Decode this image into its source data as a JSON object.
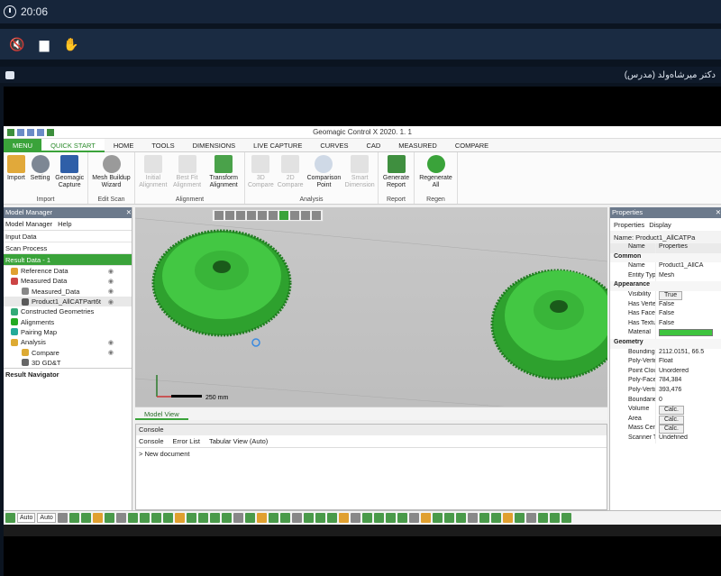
{
  "topbar": {
    "time": "20:06"
  },
  "presenter": {
    "name": "دکتر میرشاه‌ولد (مدرس)"
  },
  "app": {
    "title": "Geomagic Control X 2020. 1. 1",
    "tabs": [
      "MENU",
      "QUICK START",
      "HOME",
      "TOOLS",
      "DIMENSIONS",
      "LIVE CAPTURE",
      "CURVES",
      "CAD",
      "MEASURED",
      "COMPARE"
    ],
    "active_tab": "QUICK START",
    "ribbon": {
      "import": {
        "name": "Import",
        "buttons": [
          "Import",
          "Setting",
          "Geomagic Capture"
        ]
      },
      "edit_scan": {
        "name": "Edit Scan",
        "buttons": [
          "Mesh Buildup Wizard"
        ]
      },
      "alignment": {
        "name": "Alignment",
        "buttons": [
          "Initial Alignment",
          "Best Fit Alignment",
          "Transform Alignment"
        ]
      },
      "analysis": {
        "name": "Analysis",
        "buttons": [
          "3D Compare",
          "2D Compare",
          "Comparison Point",
          "Smart Dimension"
        ]
      },
      "report": {
        "name": "Report",
        "buttons": [
          "Generate Report"
        ]
      },
      "regen": {
        "name": "Regen",
        "buttons": [
          "Regenerate All"
        ]
      }
    },
    "model_manager": {
      "title": "Model Manager",
      "tabs": [
        "Model Manager",
        "Help"
      ],
      "input_data": "Input Data",
      "scan_process": "Scan Process",
      "result_data": "Result Data - 1",
      "items": [
        {
          "label": "Reference Data",
          "level": 1
        },
        {
          "label": "Measured Data",
          "level": 1
        },
        {
          "label": "Measured_Data",
          "level": 2
        },
        {
          "label": "Product1_AllCATPart6t",
          "level": 2
        },
        {
          "label": "Constructed Geometries",
          "level": 1
        },
        {
          "label": "Alignments",
          "level": 1
        },
        {
          "label": "Pairing Map",
          "level": 1
        },
        {
          "label": "Analysis",
          "level": 1
        },
        {
          "label": "Compare",
          "level": 2
        },
        {
          "label": "3D GD&T",
          "level": 2
        }
      ],
      "navigator": "Result Navigator"
    },
    "viewport": {
      "scale_label": "250 mm",
      "tab": "Model View"
    },
    "console": {
      "title": "Console",
      "tabs": [
        "Console",
        "Error List",
        "Tabular View (Auto)"
      ],
      "line": "> New document"
    },
    "properties": {
      "title": "Properties",
      "tabs": [
        "Properties",
        "Display"
      ],
      "name_label": "Name: Product1_AllCATPa",
      "header": {
        "k": "Name",
        "v": "Properties"
      },
      "rows": [
        {
          "cat": "Common"
        },
        {
          "k": "Name",
          "v": "Product1_AllCA"
        },
        {
          "k": "Entity Type",
          "v": "Mesh"
        },
        {
          "cat": "Appearance"
        },
        {
          "k": "Visibility",
          "v": "True"
        },
        {
          "k": "Has Vertex ...",
          "v": "False"
        },
        {
          "k": "Has Face C...",
          "v": "False"
        },
        {
          "k": "Has Texture",
          "v": "False"
        },
        {
          "k": "Material",
          "v": ""
        },
        {
          "cat": "Geometry"
        },
        {
          "k": "Bounding B...",
          "v": "2112.0151, 66.5"
        },
        {
          "k": "Poly-Vertex ...",
          "v": "Float"
        },
        {
          "k": "Point Cloud...",
          "v": "Unordered"
        },
        {
          "k": "Poly-Faces ...",
          "v": "784,384"
        },
        {
          "k": "Poly-Vertice...",
          "v": "393,476"
        },
        {
          "k": "Boundaries ...",
          "v": "0"
        },
        {
          "k": "Volume",
          "v": "Calc."
        },
        {
          "k": "Area",
          "v": "Calc."
        },
        {
          "k": "Mass Center",
          "v": "Calc."
        },
        {
          "k": "Scanner Type",
          "v": "Undefined"
        }
      ]
    },
    "statusbar": {
      "select1": "Auto",
      "select2": "Auto"
    }
  },
  "colors": {
    "accent": "#3aa33a",
    "mesh": "#3ec43e"
  }
}
